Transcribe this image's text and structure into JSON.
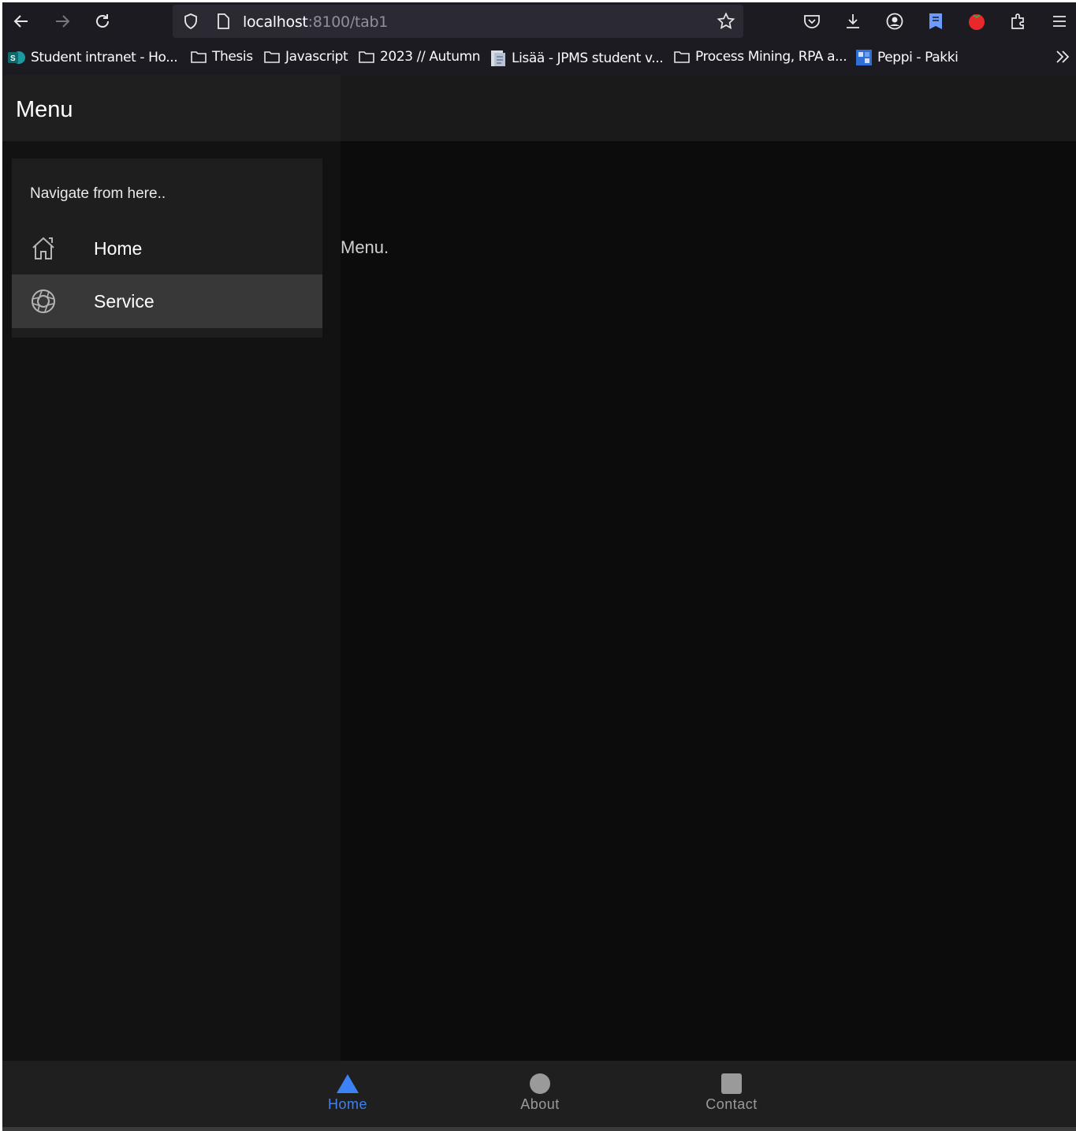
{
  "browser": {
    "url_host": "localhost",
    "url_rest": ":8100/tab1",
    "bookmarks": [
      {
        "label": "Student intranet - Ho..."
      },
      {
        "label": "Thesis"
      },
      {
        "label": "Javascript"
      },
      {
        "label": "2023 // Autumn"
      },
      {
        "label": "Lisää - JPMS student v..."
      },
      {
        "label": "Process Mining, RPA a..."
      },
      {
        "label": "Peppi - Pakki"
      }
    ]
  },
  "menu": {
    "title": "Menu",
    "list_header": "Navigate from here..",
    "items": [
      {
        "label": "Home",
        "icon": "home-outline-icon"
      },
      {
        "label": "Service",
        "icon": "aperture-outline-icon",
        "selected": true
      }
    ]
  },
  "main": {
    "content_text": "Menu."
  },
  "tabs": [
    {
      "label": "Home",
      "icon": "triangle-icon",
      "active": true
    },
    {
      "label": "About",
      "icon": "ellipse-icon",
      "active": false
    },
    {
      "label": "Contact",
      "icon": "square-icon",
      "active": false
    }
  ],
  "colors": {
    "accent": "#3b82f6",
    "selected_item": "#383838",
    "background": "#0c0c0c"
  }
}
